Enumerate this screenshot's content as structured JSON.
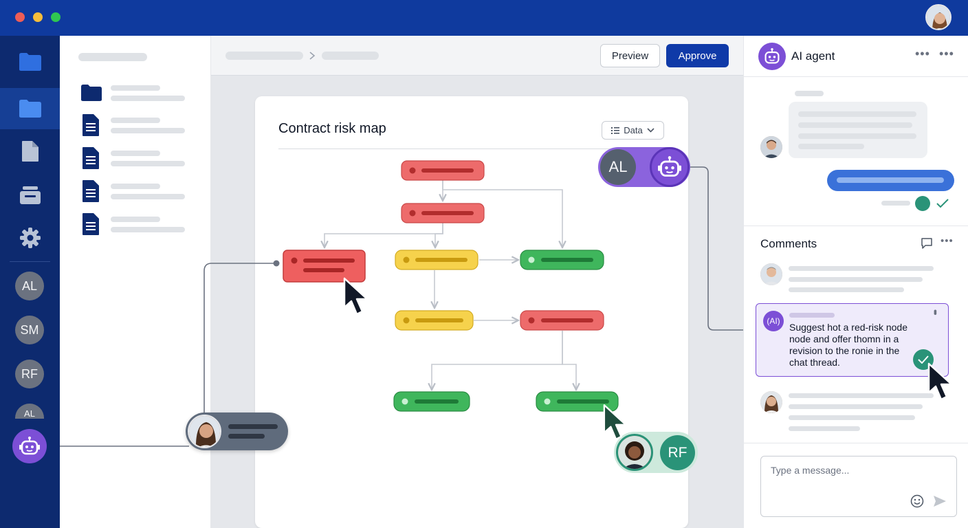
{
  "window": {
    "traffic_lights": [
      "#ee5d57",
      "#f6bd3b",
      "#2fc651"
    ]
  },
  "nav": {
    "avatars": [
      "AL",
      "SM",
      "RF",
      "AL"
    ]
  },
  "toolbar": {
    "preview_label": "Preview",
    "approve_label": "Approve"
  },
  "canvas": {
    "title": "Contract risk map",
    "data_button_label": "Data",
    "presence": {
      "agent_initials": "AL",
      "reviewer_initials": "RF"
    },
    "risk_colors": {
      "high": "#e85d5d",
      "medium": "#f4cf42",
      "low": "#3eb55c"
    }
  },
  "agent": {
    "title": "AI agent"
  },
  "comments": {
    "title": "Comments",
    "ai_badge": "(AI)",
    "ai_comment_text": "Suggest hot a red-risk node node and offer thomn in a revision to the ronie in the chat thread."
  },
  "composer": {
    "placeholder": "Type a message..."
  },
  "colors": {
    "brand": "#0f3a9e",
    "accent_purple": "#7c4fd6",
    "approve": "#0f3aa8",
    "success": "#2a9378"
  }
}
